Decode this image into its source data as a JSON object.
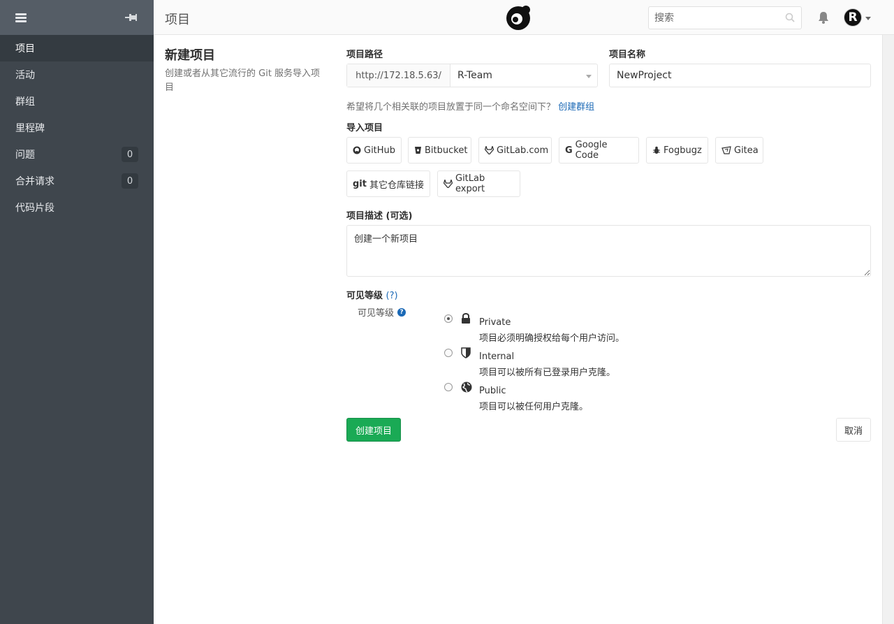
{
  "sidebar": {
    "items": [
      {
        "label": "项目",
        "count": null
      },
      {
        "label": "活动",
        "count": null
      },
      {
        "label": "群组",
        "count": null
      },
      {
        "label": "里程碑",
        "count": null
      },
      {
        "label": "问题",
        "count": "0"
      },
      {
        "label": "合并请求",
        "count": "0"
      },
      {
        "label": "代码片段",
        "count": null
      }
    ]
  },
  "header": {
    "title": "项目",
    "search_placeholder": "搜索",
    "avatar_letter": "R"
  },
  "page": {
    "title": "新建项目",
    "description": "创建或者从其它流行的 Git 服务导入项目"
  },
  "form": {
    "path_label": "项目路径",
    "path_prefix": "http://172.18.5.63/",
    "namespace_value": "R-Team",
    "name_label": "项目名称",
    "name_value": "NewProject",
    "hint_text": "希望将几个相关联的项目放置于同一个命名空间下？",
    "hint_link": "创建群组",
    "import_label": "导入项目",
    "import_sources": [
      "GitHub",
      "Bitbucket",
      "GitLab.com",
      "Google Code",
      "Fogbugz",
      "Gitea",
      "其它仓库链接",
      "GitLab export"
    ],
    "git_prefix": "git",
    "desc_label": "项目描述 (可选)",
    "desc_placeholder": "创建一个新项目",
    "visibility_label": "可见等级",
    "visibility_help": "(?)",
    "visibility_sublabel": "可见等级",
    "visibility_options": [
      {
        "title": "Private",
        "desc": "项目必须明确授权给每个用户访问。",
        "checked": true
      },
      {
        "title": "Internal",
        "desc": "项目可以被所有已登录用户克隆。",
        "checked": false
      },
      {
        "title": "Public",
        "desc": "项目可以被任何用户克隆。",
        "checked": false
      }
    ],
    "create_label": "创建项目",
    "cancel_label": "取消"
  },
  "colors": {
    "sidebar_bg": "#3f464d",
    "primary_button": "#1aaa55",
    "link": "#1b69b6"
  }
}
